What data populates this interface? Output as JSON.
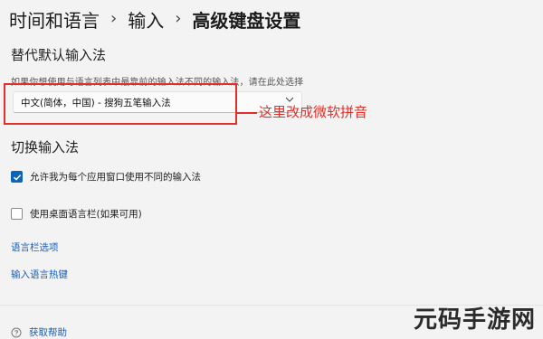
{
  "breadcrumb": {
    "items": [
      "时间和语言",
      "输入",
      "高级键盘设置"
    ],
    "separator": "›"
  },
  "override_section": {
    "title": "替代默认输入法",
    "description": "如果你想使用与语言列表中最靠前的输入法不同的输入法，请在此处选择",
    "dropdown_value": "中文(简体，中国) - 搜狗五笔输入法"
  },
  "annotation": {
    "text": "这里改成微软拼音",
    "color": "#e0302a"
  },
  "switch_section": {
    "title": "切换输入法",
    "options": [
      {
        "label": "允许我为每个应用窗口使用不同的输入法",
        "checked": true
      },
      {
        "label": "使用桌面语言栏(如果可用)",
        "checked": false
      }
    ]
  },
  "links": {
    "language_bar_options": "语言栏选项",
    "input_hotkeys": "输入语言热键"
  },
  "help": {
    "label": "获取帮助",
    "icon": "help-icon"
  },
  "watermark": "元码手游网",
  "colors": {
    "accent": "#0a64b8",
    "link": "#1a5fb4",
    "annotation": "#e0302a"
  }
}
